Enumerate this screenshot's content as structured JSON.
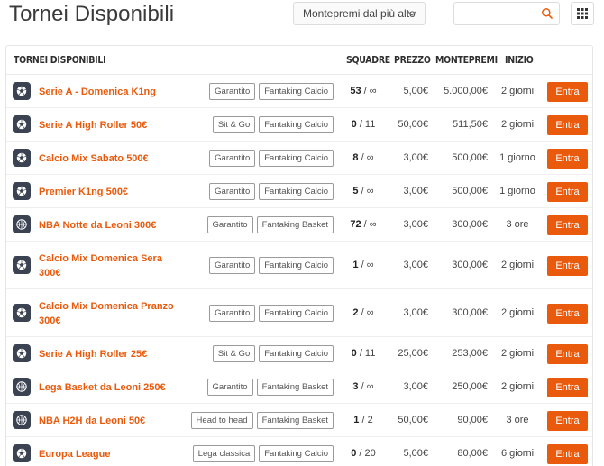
{
  "header": {
    "title": "Tornei Disponibili",
    "sort_label": "Montepremi dal più alto",
    "search_placeholder": "",
    "search_value": ""
  },
  "table": {
    "columns": {
      "name": "TORNEI DISPONIBILI",
      "squadre": "SQUADRE",
      "prezzo": "PREZZO",
      "montepremi": "MONTEPREMI",
      "inizio": "INIZIO"
    },
    "rows": [
      {
        "logo": "soccer-ball-icon",
        "name": "Serie A - Domenica K1ng",
        "tags": [
          "Garantito",
          "Fantaking Calcio"
        ],
        "squadre_count": "53",
        "squadre_max": " / ∞",
        "prezzo": "5,00€",
        "montepremi": "5.000,00€",
        "inizio": "2 giorni",
        "action": "Entra"
      },
      {
        "logo": "soccer-ball-icon",
        "name": "Serie A High Roller 50€",
        "tags": [
          "Sit & Go",
          "Fantaking Calcio"
        ],
        "squadre_count": "0",
        "squadre_max": " / 11",
        "prezzo": "50,00€",
        "montepremi": "511,50€",
        "inizio": "2 giorni",
        "action": "Entra"
      },
      {
        "logo": "soccer-ball-icon",
        "name": "Calcio Mix Sabato 500€",
        "tags": [
          "Garantito",
          "Fantaking Calcio"
        ],
        "squadre_count": "8",
        "squadre_max": " / ∞",
        "prezzo": "3,00€",
        "montepremi": "500,00€",
        "inizio": "1 giorno",
        "action": "Entra"
      },
      {
        "logo": "soccer-ball-icon",
        "name": "Premier K1ng 500€",
        "tags": [
          "Garantito",
          "Fantaking Calcio"
        ],
        "squadre_count": "5",
        "squadre_max": " / ∞",
        "prezzo": "3,00€",
        "montepremi": "500,00€",
        "inizio": "1 giorno",
        "action": "Entra"
      },
      {
        "logo": "basketball-icon",
        "name": "NBA Notte da Leoni 300€",
        "tags": [
          "Garantito",
          "Fantaking Basket"
        ],
        "squadre_count": "72",
        "squadre_max": " / ∞",
        "prezzo": "3,00€",
        "montepremi": "300,00€",
        "inizio": "3 ore",
        "action": "Entra"
      },
      {
        "logo": "soccer-ball-icon",
        "name": "Calcio Mix Domenica Sera 300€",
        "tags": [
          "Garantito",
          "Fantaking Calcio"
        ],
        "squadre_count": "1",
        "squadre_max": " / ∞",
        "prezzo": "3,00€",
        "montepremi": "300,00€",
        "inizio": "2 giorni",
        "action": "Entra"
      },
      {
        "logo": "soccer-ball-icon",
        "name": "Calcio Mix Domenica Pranzo 300€",
        "tags": [
          "Garantito",
          "Fantaking Calcio"
        ],
        "squadre_count": "2",
        "squadre_max": " / ∞",
        "prezzo": "3,00€",
        "montepremi": "300,00€",
        "inizio": "2 giorni",
        "action": "Entra"
      },
      {
        "logo": "soccer-ball-icon",
        "name": "Serie A High Roller 25€",
        "tags": [
          "Sit & Go",
          "Fantaking Calcio"
        ],
        "squadre_count": "0",
        "squadre_max": " / 11",
        "prezzo": "25,00€",
        "montepremi": "253,00€",
        "inizio": "2 giorni",
        "action": "Entra"
      },
      {
        "logo": "basketball-icon",
        "name": "Lega Basket da Leoni 250€",
        "tags": [
          "Garantito",
          "Fantaking Basket"
        ],
        "squadre_count": "3",
        "squadre_max": " / ∞",
        "prezzo": "3,00€",
        "montepremi": "250,00€",
        "inizio": "2 giorni",
        "action": "Entra"
      },
      {
        "logo": "basketball-icon",
        "name": "NBA H2H da Leoni 50€",
        "tags": [
          "Head to head",
          "Fantaking Basket"
        ],
        "squadre_count": "1",
        "squadre_max": " / 2",
        "prezzo": "50,00€",
        "montepremi": "90,00€",
        "inizio": "3 ore",
        "action": "Entra"
      },
      {
        "logo": "soccer-ball-icon",
        "name": "Europa League",
        "tags": [
          "Lega classica",
          "Fantaking Calcio"
        ],
        "squadre_count": "0",
        "squadre_max": " / 20",
        "prezzo": "5,00€",
        "montepremi": "80,00€",
        "inizio": "6 giorni",
        "action": "Entra"
      }
    ]
  },
  "colors": {
    "accent": "#ea5a0c",
    "logo_bg": "#3b4252"
  }
}
